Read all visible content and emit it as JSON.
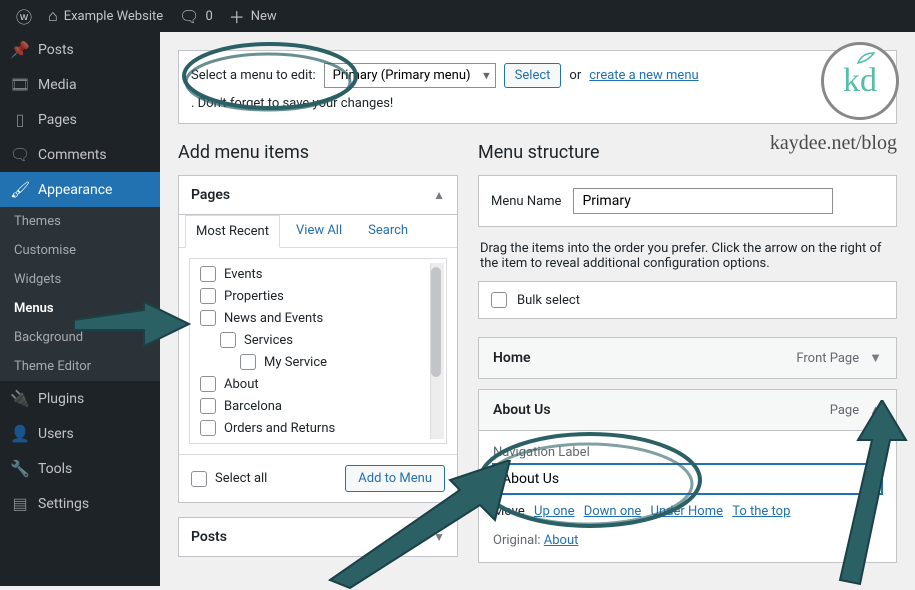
{
  "adminbar": {
    "site_name": "Example Website",
    "comments_count": "0",
    "new_label": "New"
  },
  "sidebar": {
    "items": [
      {
        "icon": "📌",
        "label": "Posts"
      },
      {
        "icon": "🎞",
        "label": "Media"
      },
      {
        "icon": "▦",
        "label": "Pages"
      },
      {
        "icon": "💬",
        "label": "Comments"
      },
      {
        "icon": "🖌",
        "label": "Appearance",
        "current": true
      },
      {
        "icon": "🔌",
        "label": "Plugins"
      },
      {
        "icon": "👤",
        "label": "Users"
      },
      {
        "icon": "🔧",
        "label": "Tools"
      },
      {
        "icon": "⚙",
        "label": "Settings"
      }
    ],
    "submenu": [
      {
        "label": "Themes"
      },
      {
        "label": "Customise"
      },
      {
        "label": "Widgets"
      },
      {
        "label": "Menus",
        "bold": true
      },
      {
        "label": "Background"
      },
      {
        "label": "Theme Editor"
      }
    ]
  },
  "manage": {
    "select_label": "Select a menu to edit:",
    "dropdown_value": "Primary (Primary menu)",
    "select_button": "Select",
    "or_text": "or",
    "create_link": "create a new menu",
    "tail_text": ". Don't forget to save your changes!"
  },
  "cols": {
    "left_title": "Add menu items",
    "right_title": "Menu structure"
  },
  "pages_panel": {
    "title": "Pages",
    "tabs": [
      "Most Recent",
      "View All",
      "Search"
    ],
    "pages": [
      {
        "label": "Events"
      },
      {
        "label": "Properties"
      },
      {
        "label": "News and Events"
      },
      {
        "label": "Services",
        "indent": 1
      },
      {
        "label": "My Service",
        "indent": 2
      },
      {
        "label": "About"
      },
      {
        "label": "Barcelona"
      },
      {
        "label": "Orders and Returns"
      }
    ],
    "select_all": "Select all",
    "add_button": "Add to Menu"
  },
  "posts_panel": {
    "title": "Posts"
  },
  "menu_name": {
    "label": "Menu Name",
    "value": "Primary"
  },
  "instructions": "Drag the items into the order you prefer. Click the arrow on the right of the item to reveal additional configuration options.",
  "bulk": {
    "label": "Bulk select"
  },
  "menu_items": [
    {
      "title": "Home",
      "type": "Front Page",
      "expanded": false
    },
    {
      "title": "About Us",
      "type": "Page",
      "expanded": true,
      "nav_label_field": "Navigation Label",
      "nav_label_value": "About Us",
      "move_label": "Move",
      "move_links": [
        "Up one",
        "Down one",
        "Under Home",
        "To the top"
      ],
      "original_label": "Original:",
      "original_link": "About"
    }
  ],
  "branding": {
    "blog_url": "kaydee.net/blog"
  }
}
